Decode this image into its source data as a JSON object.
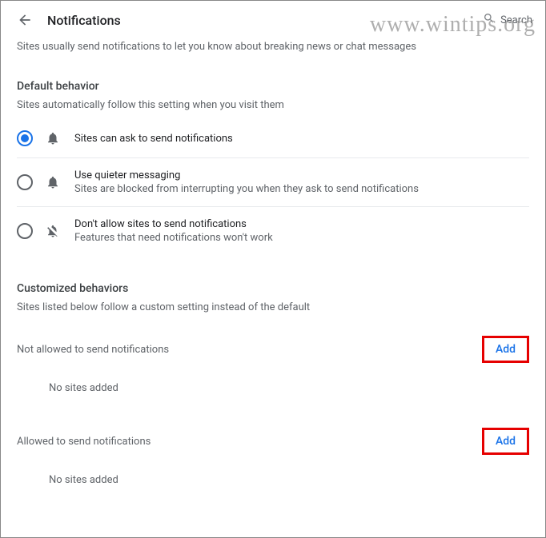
{
  "watermark": "www.wintips.org",
  "header": {
    "title": "Notifications",
    "search_placeholder": "Search"
  },
  "intro": "Sites usually send notifications to let you know about breaking news or chat messages",
  "default_behavior": {
    "title": "Default behavior",
    "subtitle": "Sites automatically follow this setting when you visit them",
    "options": [
      {
        "label": "Sites can ask to send notifications",
        "sub": "",
        "selected": true,
        "icon": "bell"
      },
      {
        "label": "Use quieter messaging",
        "sub": "Sites are blocked from interrupting you when they ask to send notifications",
        "selected": false,
        "icon": "bell"
      },
      {
        "label": "Don't allow sites to send notifications",
        "sub": "Features that need notifications won't work",
        "selected": false,
        "icon": "bell-off"
      }
    ]
  },
  "customized": {
    "title": "Customized behaviors",
    "subtitle": "Sites listed below follow a custom setting instead of the default",
    "blocked": {
      "header": "Not allowed to send notifications",
      "add_label": "Add",
      "empty": "No sites added"
    },
    "allowed": {
      "header": "Allowed to send notifications",
      "add_label": "Add",
      "empty": "No sites added"
    }
  }
}
